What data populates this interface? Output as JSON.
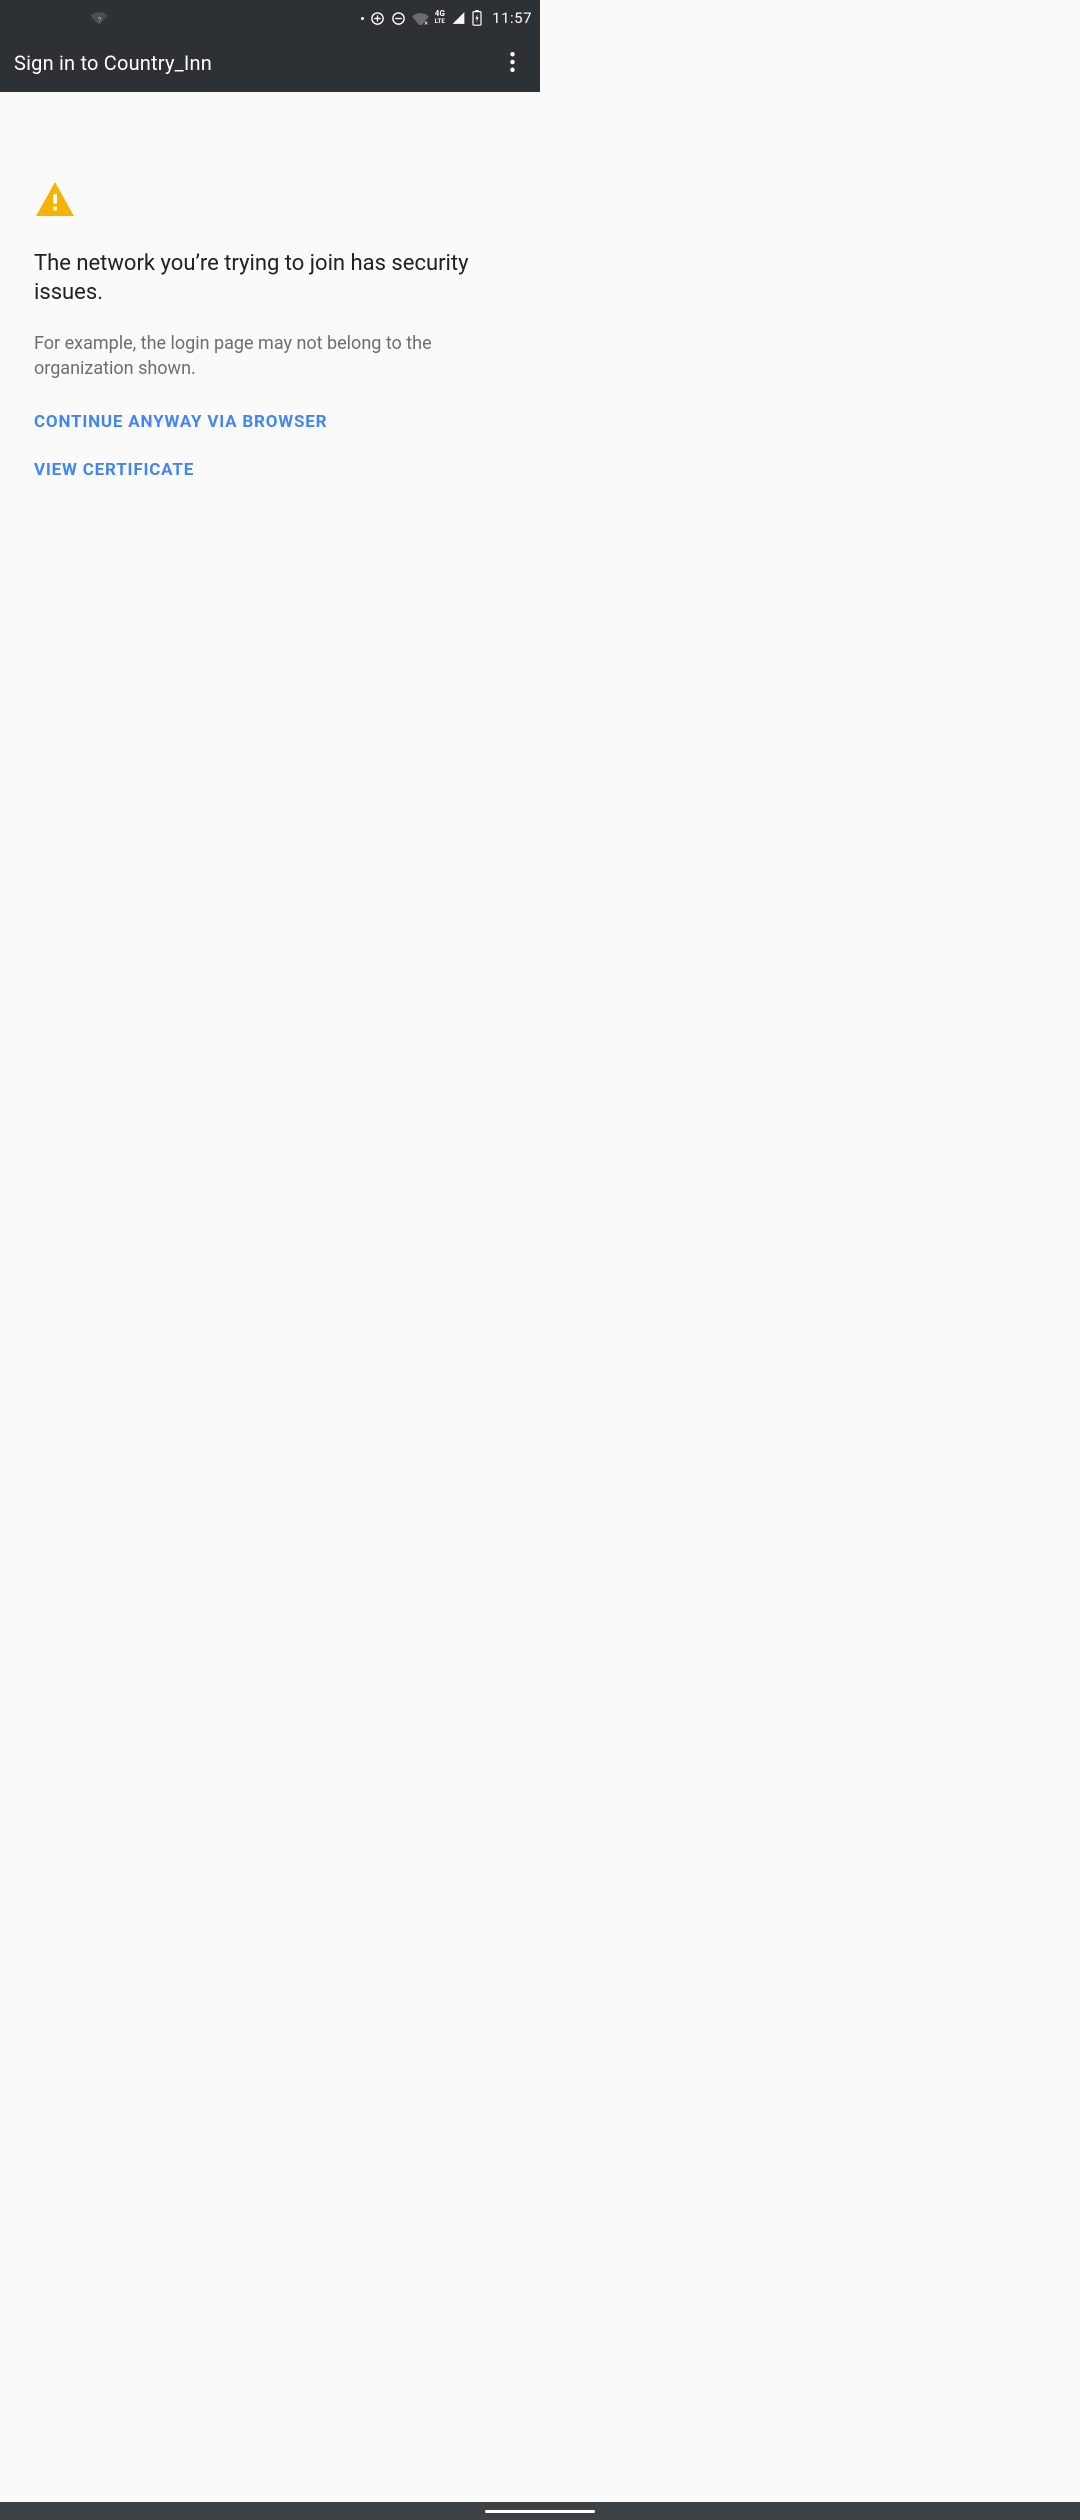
{
  "status": {
    "time": "11:57",
    "network_type": "4G",
    "network_sub": "LTE"
  },
  "appbar": {
    "title": "Sign in to Country_Inn"
  },
  "content": {
    "headline": "The network you’re trying to join has security issues.",
    "subtext": "For example, the login page may not belong to the organization shown.",
    "action_continue": "CONTINUE ANYWAY VIA BROWSER",
    "action_view_cert": "VIEW CERTIFICATE"
  }
}
